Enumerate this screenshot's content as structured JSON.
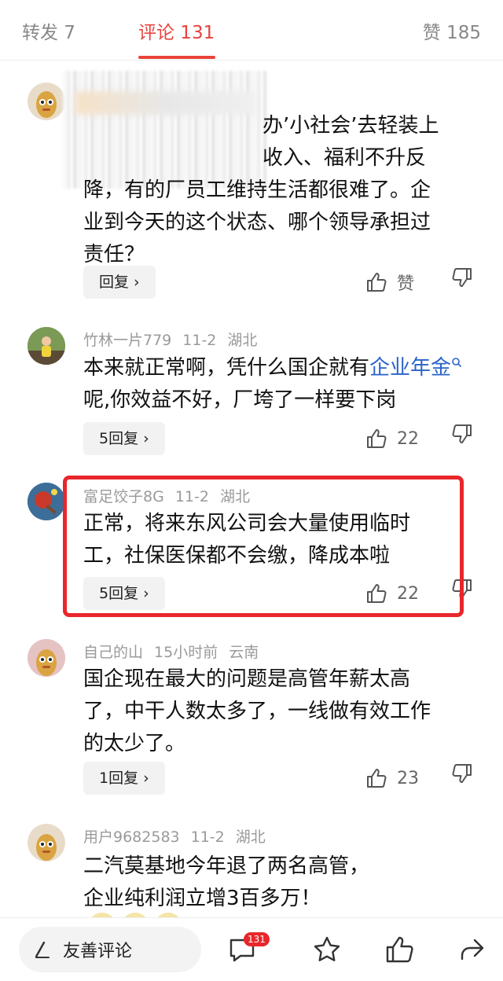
{
  "tabs": {
    "repost": "转发 7",
    "comments": "评论 131",
    "likes": "赞 185"
  },
  "comments": [
    {
      "user": "",
      "date": "",
      "location": "",
      "text_lines": [
        "办’小社会’去轻装上",
        "收入、福利不升反",
        "降，有的厂员工维持生活都很难了。企",
        "业到今天的这个状态、哪个领导承担过",
        "责任？"
      ],
      "reply_label": "回复 ›",
      "like_label": "赞"
    },
    {
      "user": "竹林一片779",
      "date": "11-2",
      "location": "湖北",
      "text_before_link": "本来就正常啊，凭什么国企就有",
      "link_text": "企业年金",
      "text_after_link": "呢,你效益不好，厂垮了一样要下岗",
      "reply_label": "5回复 ›",
      "like_count": "22"
    },
    {
      "user": "富足饺子8G",
      "date": "11-2",
      "location": "湖北",
      "text_lines": [
        "正常，将来东风公司会大量使用临时",
        "工，社保医保都不会缴，降成本啦"
      ],
      "reply_label": "5回复 ›",
      "like_count": "22"
    },
    {
      "user": "自己的山",
      "date": "15小时前",
      "location": "云南",
      "text_lines": [
        "国企现在最大的问题是高管年薪太高",
        "了，中干人数太多了，一线做有效工作",
        "的太少了。"
      ],
      "reply_label": "1回复 ›",
      "like_count": "23"
    },
    {
      "user": "用户9682583",
      "date": "11-2",
      "location": "湖北",
      "text_lines": [
        "二汽莫基地今年退了两名高管，",
        "企业纯利润立增3百多万！"
      ]
    }
  ],
  "bottom_bar": {
    "placeholder": "友善评论",
    "comment_badge": "131"
  },
  "colors": {
    "accent": "#e8433c",
    "highlight_border": "#e8262b",
    "link": "#2a63c7"
  }
}
